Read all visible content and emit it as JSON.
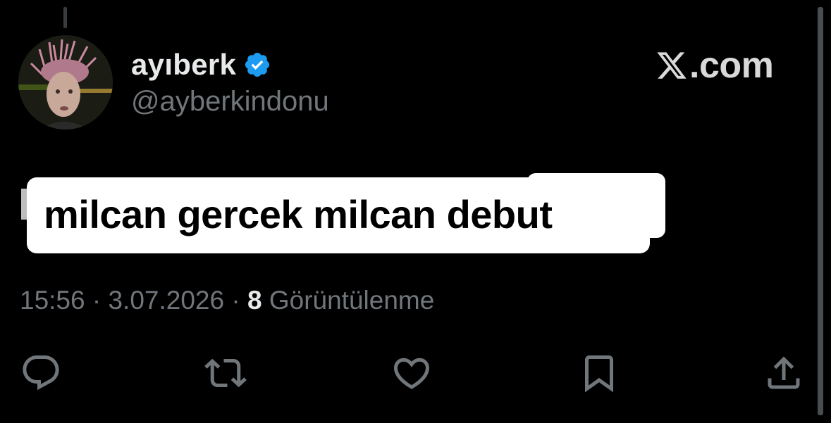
{
  "tweet": {
    "author": {
      "display_name": "ayıberk",
      "handle": "@ayberkindonu",
      "verified": true,
      "verified_color": "#1d9bf0"
    },
    "brand": {
      "icon": "x-logo-icon",
      "text": ".com"
    },
    "caption": "milcan gercek milcan debut",
    "meta": {
      "time": "15:56",
      "separator": "·",
      "date": "3.07.2026",
      "views_count": "8",
      "views_label": "Görüntülenme"
    },
    "actions": [
      {
        "name": "reply",
        "icon": "reply-icon"
      },
      {
        "name": "repost",
        "icon": "repost-icon"
      },
      {
        "name": "like",
        "icon": "heart-icon"
      },
      {
        "name": "bookmark",
        "icon": "bookmark-icon"
      },
      {
        "name": "share",
        "icon": "share-icon"
      }
    ]
  },
  "colors": {
    "background": "#000000",
    "primary_text": "#e7e9ea",
    "secondary_text": "#71767b",
    "caption_bg": "#ffffff",
    "caption_text": "#000000"
  }
}
